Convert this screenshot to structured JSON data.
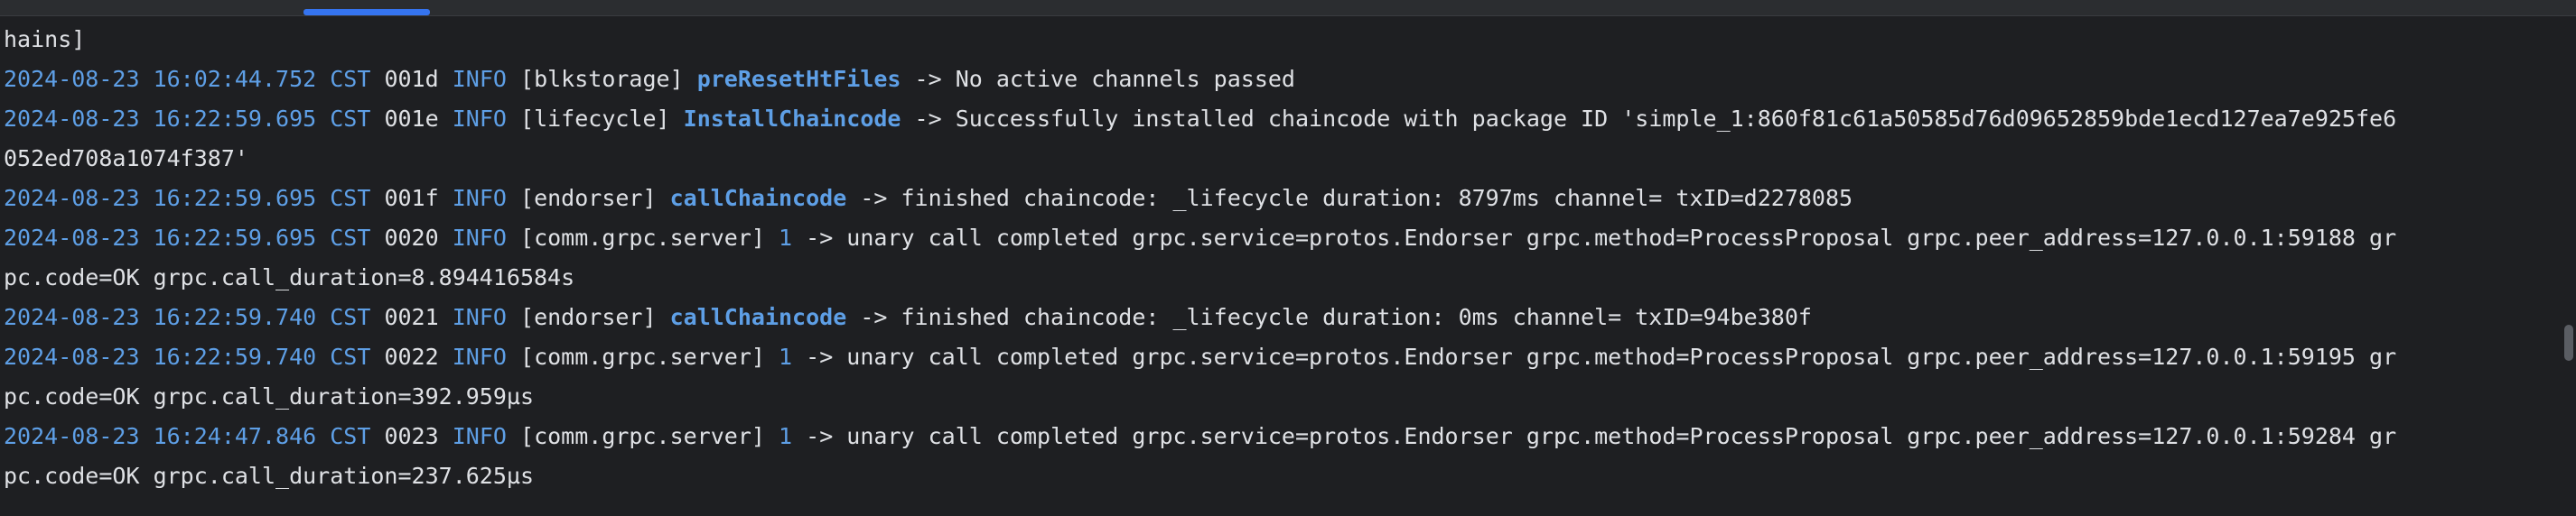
{
  "console": {
    "lines": [
      {
        "msg": "hains]"
      },
      {
        "ts": "2024-08-23 16:02:44.752 CST",
        "seq": "001d",
        "level": "INFO",
        "module": "[blkstorage]",
        "fn": "preResetHtFiles",
        "msg": "-> No active channels passed"
      },
      {
        "ts": "2024-08-23 16:22:59.695 CST",
        "seq": "001e",
        "level": "INFO",
        "module": "[lifecycle]",
        "fn": "InstallChaincode",
        "msg": "-> Successfully installed chaincode with package ID 'simple_1:860f81c61a50585d76d09652859bde1ecd127ea7e925fe6"
      },
      {
        "msg": "052ed708a1074f387'"
      },
      {
        "ts": "2024-08-23 16:22:59.695 CST",
        "seq": "001f",
        "level": "INFO",
        "module": "[endorser]",
        "fn": "callChaincode",
        "msg": "-> finished chaincode: _lifecycle duration: 8797ms channel= txID=d2278085"
      },
      {
        "ts": "2024-08-23 16:22:59.695 CST",
        "seq": "0020",
        "level": "INFO",
        "module": "[comm.grpc.server]",
        "num": "1",
        "msg": "-> unary call completed grpc.service=protos.Endorser grpc.method=ProcessProposal grpc.peer_address=127.0.0.1:59188 gr"
      },
      {
        "msg": "pc.code=OK grpc.call_duration=8.894416584s"
      },
      {
        "ts": "2024-08-23 16:22:59.740 CST",
        "seq": "0021",
        "level": "INFO",
        "module": "[endorser]",
        "fn": "callChaincode",
        "msg": "-> finished chaincode: _lifecycle duration: 0ms channel= txID=94be380f"
      },
      {
        "ts": "2024-08-23 16:22:59.740 CST",
        "seq": "0022",
        "level": "INFO",
        "module": "[comm.grpc.server]",
        "num": "1",
        "msg": "-> unary call completed grpc.service=protos.Endorser grpc.method=ProcessProposal grpc.peer_address=127.0.0.1:59195 gr"
      },
      {
        "msg": "pc.code=OK grpc.call_duration=392.959µs"
      },
      {
        "ts": "2024-08-23 16:24:47.846 CST",
        "seq": "0023",
        "level": "INFO",
        "module": "[comm.grpc.server]",
        "num": "1",
        "msg": "-> unary call completed grpc.service=protos.Endorser grpc.method=ProcessProposal grpc.peer_address=127.0.0.1:59284 gr"
      },
      {
        "msg": "pc.code=OK grpc.call_duration=237.625µs"
      }
    ]
  },
  "colors": {
    "background": "#1e1f22",
    "text": "#dfe1e5",
    "timestamp": "#5e9fe6",
    "function": "#5e9fe6",
    "tab_indicator": "#3574f0"
  }
}
